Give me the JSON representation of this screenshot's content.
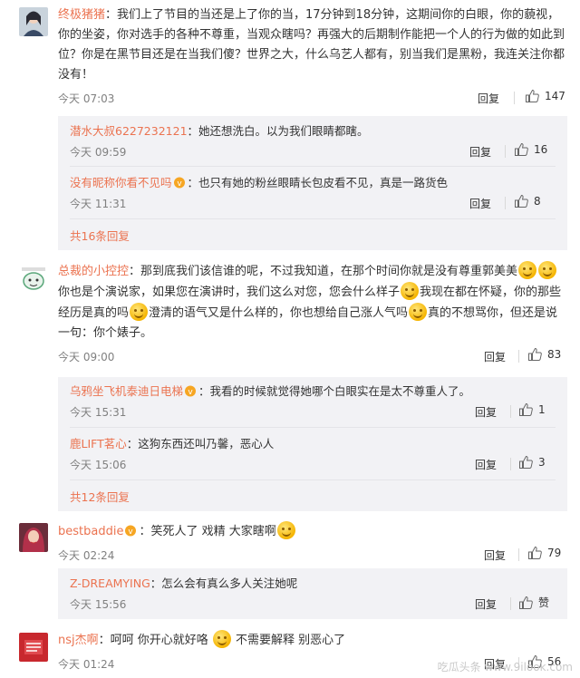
{
  "comments": [
    {
      "user": "终极猪猪",
      "text": "：我们上了节目的当还是上了你的当，17分钟到18分钟，这期间你的白眼，你的藐视，你的坐姿，你对选手的各种不尊重，当观众瞎吗？再强大的后期制作能把一个人的行为做的如此到位？你是在黑节目还是在当我们傻？世界之大，什么乌艺人都有，别当我们是黑粉，我连关注你都没有！",
      "time": "今天 07:03",
      "reply": "回复",
      "likes": "147",
      "replies": [
        {
          "user": "潜水大叔6227232121",
          "text": "：她还想洗白。以为我们眼睛都瞎。",
          "time": "今天 09:59",
          "reply": "回复",
          "likes": "16"
        },
        {
          "user": "没有昵称你看不见吗",
          "text": "：也只有她的粉丝眼睛长包皮看不见，真是一路货色",
          "time": "今天 11:31",
          "reply": "回复",
          "likes": "8"
        }
      ],
      "more": "共16条回复"
    },
    {
      "user": "总裁的小控控",
      "text_parts": [
        "：那到底我们该信谁的呢，不过我知道，在那个时间你就是没有尊重郭美美",
        "你也是个演说家，如果您在演讲时，我们这么对您，您会什么样子",
        "我现在都在怀疑，你的那些经历是真的吗",
        "澄清的语气又是什么样的，你也想给自己涨人气吗",
        "真的不想骂你，但还是说一句：你个婊子。"
      ],
      "time": "今天 09:00",
      "reply": "回复",
      "likes": "83",
      "replies": [
        {
          "user": "乌鸦坐飞机泰迪日电梯",
          "text": "：我看的时候就觉得她哪个白眼实在是太不尊重人了。",
          "time": "今天 15:31",
          "reply": "回复",
          "likes": "1"
        },
        {
          "user": "鹿LIFT茗心",
          "text": "：这狗东西还叫乃馨，恶心人",
          "time": "今天 15:06",
          "reply": "回复",
          "likes": "3"
        }
      ],
      "more": "共12条回复"
    },
    {
      "user": "bestbaddie",
      "text": "：笑死人了 戏精 大家瞎啊",
      "time": "今天 02:24",
      "reply": "回复",
      "likes": "79",
      "replies": [
        {
          "user": "Z-DREAMYING",
          "text": "：怎么会有真么多人关注她呢",
          "time": "今天 15:56",
          "reply": "回复",
          "likes": "赞"
        }
      ]
    },
    {
      "user": "nsj杰啊",
      "text_a": "：呵呵 你开心就好咯",
      "text_b": "不需要解释 别恶心了",
      "time": "今天 01:24",
      "reply": "回复",
      "likes": "56"
    }
  ],
  "watermark": "吃瓜头条 www.9ilook.com",
  "colors": {
    "username": "#eb7350",
    "reply_bg": "#f2f2f5",
    "meta": "#808080"
  }
}
